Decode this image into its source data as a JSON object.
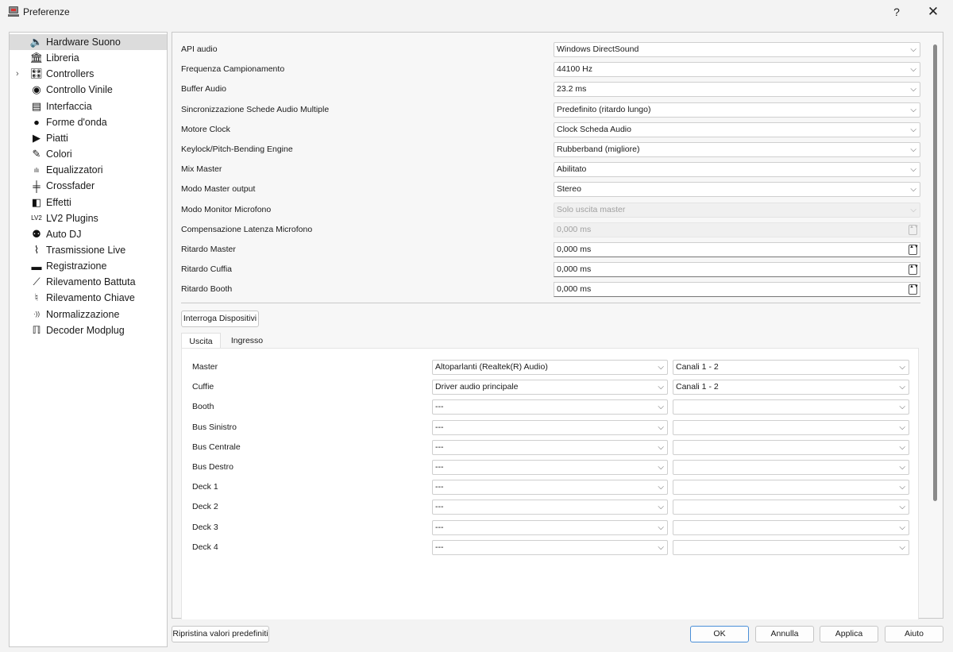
{
  "window": {
    "title": "Preferenze",
    "help_label": "?",
    "close_label": "✕"
  },
  "sidebar": {
    "items": [
      {
        "label": "Hardware Suono",
        "icon": "speaker-icon",
        "glyph": "🔈"
      },
      {
        "label": "Libreria",
        "icon": "library-icon",
        "glyph": "🏛"
      },
      {
        "label": "Controllers",
        "icon": "controller-icon",
        "glyph": "🎛"
      },
      {
        "label": "Controllo Vinile",
        "icon": "vinyl-icon",
        "glyph": "◉"
      },
      {
        "label": "Interfaccia",
        "icon": "interface-icon",
        "glyph": "▤"
      },
      {
        "label": "Forme d'onda",
        "icon": "waveform-icon",
        "glyph": "⦁"
      },
      {
        "label": "Piatti",
        "icon": "play-icon",
        "glyph": "▶"
      },
      {
        "label": "Colori",
        "icon": "palette-icon",
        "glyph": "✎"
      },
      {
        "label": "Equalizzatori",
        "icon": "equalizer-icon",
        "glyph": "ılı"
      },
      {
        "label": "Crossfader",
        "icon": "crossfader-icon",
        "glyph": "╪"
      },
      {
        "label": "Effetti",
        "icon": "effects-icon",
        "glyph": "◧"
      },
      {
        "label": "LV2 Plugins",
        "icon": "lv2-icon",
        "glyph": "LV2"
      },
      {
        "label": "Auto DJ",
        "icon": "robot-icon",
        "glyph": "⚉"
      },
      {
        "label": "Trasmissione Live",
        "icon": "broadcast-icon",
        "glyph": "⌇"
      },
      {
        "label": "Registrazione",
        "icon": "recording-icon",
        "glyph": "▬"
      },
      {
        "label": "Rilevamento Battuta",
        "icon": "metronome-icon",
        "glyph": "⟋"
      },
      {
        "label": "Rilevamento Chiave",
        "icon": "key-icon",
        "glyph": "♮"
      },
      {
        "label": "Normalizzazione",
        "icon": "normalize-icon",
        "glyph": "·))"
      },
      {
        "label": "Decoder Modplug",
        "icon": "modplug-icon",
        "glyph": "ℿ"
      }
    ],
    "expander_glyph": "›"
  },
  "settings": [
    {
      "label": "API audio",
      "value": "Windows DirectSound",
      "kind": "combo",
      "enabled": true
    },
    {
      "label": "Frequenza Campionamento",
      "value": "44100 Hz",
      "kind": "combo",
      "enabled": true
    },
    {
      "label": "Buffer Audio",
      "value": "23.2 ms",
      "kind": "combo",
      "enabled": true
    },
    {
      "label": "Sincronizzazione Schede Audio Multiple",
      "value": "Predefinito (ritardo lungo)",
      "kind": "combo",
      "enabled": true
    },
    {
      "label": "Motore Clock",
      "value": "Clock Scheda Audio",
      "kind": "combo",
      "enabled": true
    },
    {
      "label": "Keylock/Pitch-Bending Engine",
      "value": "Rubberband (migliore)",
      "kind": "combo",
      "enabled": true
    },
    {
      "label": "Mix Master",
      "value": "Abilitato",
      "kind": "combo",
      "enabled": true
    },
    {
      "label": "Modo Master output",
      "value": "Stereo",
      "kind": "combo",
      "enabled": true
    },
    {
      "label": "Modo Monitor Microfono",
      "value": "Solo uscita master",
      "kind": "combo",
      "enabled": false
    },
    {
      "label": "Compensazione Latenza Microfono",
      "value": "0,000 ms",
      "kind": "spin",
      "enabled": false
    },
    {
      "label": "Ritardo Master",
      "value": "0,000 ms",
      "kind": "spin",
      "enabled": true
    },
    {
      "label": "Ritardo Cuffia",
      "value": "0,000 ms",
      "kind": "spin",
      "enabled": true
    },
    {
      "label": "Ritardo Booth",
      "value": "0,000 ms",
      "kind": "spin",
      "enabled": true
    }
  ],
  "query_devices_label": "Interroga Dispositivi",
  "tabs": [
    {
      "label": "Uscita"
    },
    {
      "label": "Ingresso"
    }
  ],
  "outputs": [
    {
      "label": "Master",
      "device": "Altoparlanti (Realtek(R) Audio)",
      "channels": "Canali 1 - 2"
    },
    {
      "label": "Cuffie",
      "device": "Driver audio principale",
      "channels": "Canali 1 - 2"
    },
    {
      "label": "Booth",
      "device": "---",
      "channels": ""
    },
    {
      "label": "Bus Sinistro",
      "device": "---",
      "channels": ""
    },
    {
      "label": "Bus Centrale",
      "device": "---",
      "channels": ""
    },
    {
      "label": "Bus Destro",
      "device": "---",
      "channels": ""
    },
    {
      "label": "Deck 1",
      "device": "---",
      "channels": ""
    },
    {
      "label": "Deck 2",
      "device": "---",
      "channels": ""
    },
    {
      "label": "Deck 3",
      "device": "---",
      "channels": ""
    },
    {
      "label": "Deck 4",
      "device": "---",
      "channels": ""
    }
  ],
  "footer": {
    "restore_defaults_label": "Ripristina valori predefiniti",
    "ok_label": "OK",
    "cancel_label": "Annulla",
    "apply_label": "Applica",
    "help_label": "Aiuto"
  },
  "chevron_glyph": "⌵",
  "spin_glyph": "▲▼"
}
